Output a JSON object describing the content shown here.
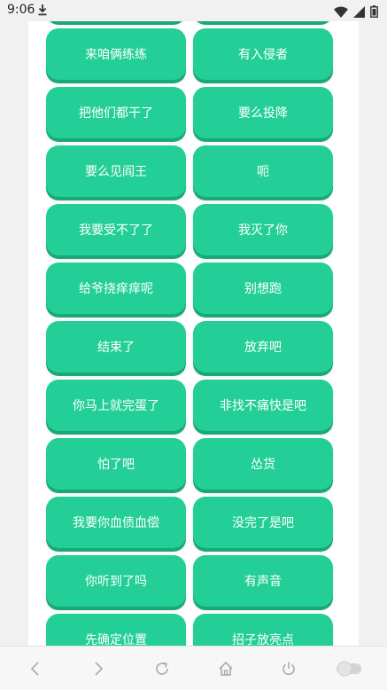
{
  "status": {
    "time": "9:06",
    "icons": [
      "download-icon",
      "wifi-icon",
      "signal-icon",
      "battery-icon"
    ]
  },
  "buttons": [
    {
      "label": ""
    },
    {
      "label": ""
    },
    {
      "label": "来咱俩练练"
    },
    {
      "label": "有入侵者"
    },
    {
      "label": "把他们都干了"
    },
    {
      "label": "要么投降"
    },
    {
      "label": "要么见阎王"
    },
    {
      "label": "呃"
    },
    {
      "label": "我要受不了了"
    },
    {
      "label": "我灭了你"
    },
    {
      "label": "给爷挠痒痒呢"
    },
    {
      "label": "别想跑"
    },
    {
      "label": "结束了"
    },
    {
      "label": "放弃吧"
    },
    {
      "label": "你马上就完蛋了"
    },
    {
      "label": "非找不痛快是吧"
    },
    {
      "label": "怕了吧"
    },
    {
      "label": "怂货"
    },
    {
      "label": "我要你血债血偿"
    },
    {
      "label": "没完了是吧"
    },
    {
      "label": "你听到了吗"
    },
    {
      "label": "有声音"
    },
    {
      "label": "先确定位置"
    },
    {
      "label": "招子放亮点"
    }
  ],
  "nav": {
    "items": [
      "back-icon",
      "forward-icon",
      "reload-icon",
      "home-icon",
      "power-icon",
      "toggle-icon"
    ]
  },
  "colors": {
    "accent": "#23cf97",
    "accent_shadow": "#19a877",
    "background": "#f1f1f1",
    "card": "#ffffff"
  }
}
